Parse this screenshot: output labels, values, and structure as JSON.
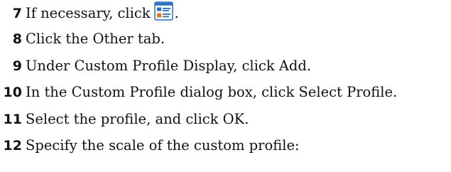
{
  "steps": [
    {
      "number": "7",
      "text": "If necessary, click",
      "suffix": ".",
      "icon": "property-palette-icon"
    },
    {
      "number": "8",
      "text": "Click the Other tab."
    },
    {
      "number": "9",
      "text": "Under Custom Profile Display, click Add."
    },
    {
      "number": "10",
      "text": "In the Custom Profile dialog box, click Select Profile."
    },
    {
      "number": "11",
      "text": "Select the profile, and click OK."
    },
    {
      "number": "12",
      "text": "Specify the scale of the custom profile:"
    }
  ],
  "colors": {
    "text": "#111111",
    "icon_blue": "#2a6fc2",
    "icon_orange": "#e07a1f"
  }
}
